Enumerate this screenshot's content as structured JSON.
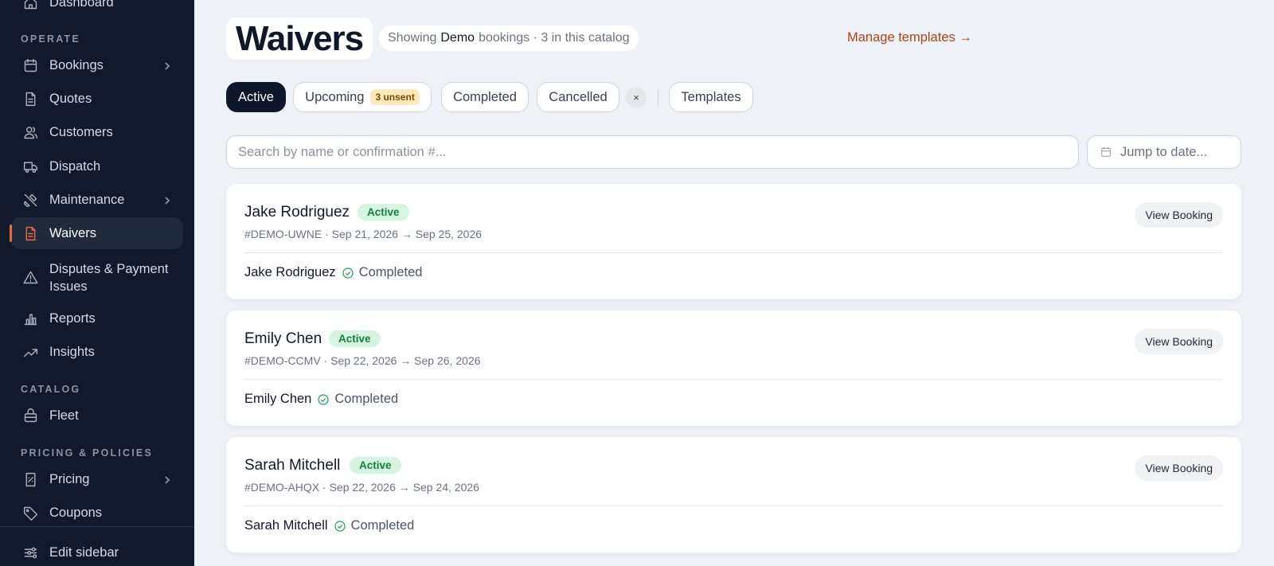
{
  "sidebar": {
    "top_item": "Dashboard",
    "sections": {
      "operate": "OPERATE",
      "catalog": "CATALOG",
      "pricing": "PRICING & POLICIES"
    },
    "items": {
      "bookings": "Bookings",
      "quotes": "Quotes",
      "customers": "Customers",
      "dispatch": "Dispatch",
      "maintenance": "Maintenance",
      "waivers": "Waivers",
      "disputes_1": "Disputes & Payment",
      "disputes_2": "Issues",
      "reports": "Reports",
      "insights": "Insights",
      "fleet": "Fleet",
      "pricing": "Pricing",
      "coupons": "Coupons"
    },
    "edit_sidebar": "Edit sidebar",
    "accent_color": "#f0693a"
  },
  "header": {
    "title": "Waivers",
    "showing_prefix": "Showing",
    "showing_catalog": "Demo",
    "showing_suffix": "bookings · 3 in this catalog",
    "manage_link": "Manage templates →"
  },
  "tabs": {
    "active": "Active",
    "upcoming": "Upcoming",
    "upcoming_badge": "3 unsent",
    "completed": "Completed",
    "cancelled": "Cancelled",
    "clear": "×",
    "templates": "Templates"
  },
  "search": {
    "placeholder": "Search by name or confirmation #...",
    "date_placeholder": "Jump to date..."
  },
  "cards": [
    {
      "name": "Jake Rodriguez",
      "status": "Active",
      "meta": "#DEMO-UWNE · Sep 21, 2026 → Sep 25, 2026",
      "signer": "Jake Rodriguez",
      "signer_status": "Completed",
      "action": "View Booking"
    },
    {
      "name": "Emily Chen",
      "status": "Active",
      "meta": "#DEMO-CCMV · Sep 22, 2026 → Sep 26, 2026",
      "signer": "Emily Chen",
      "signer_status": "Completed",
      "action": "View Booking"
    },
    {
      "name": "Sarah Mitchell",
      "status": "Active",
      "meta": "#DEMO-AHQX · Sep 22, 2026 → Sep 24, 2026",
      "signer": "Sarah Mitchell",
      "signer_status": "Completed",
      "action": "View Booking"
    }
  ]
}
